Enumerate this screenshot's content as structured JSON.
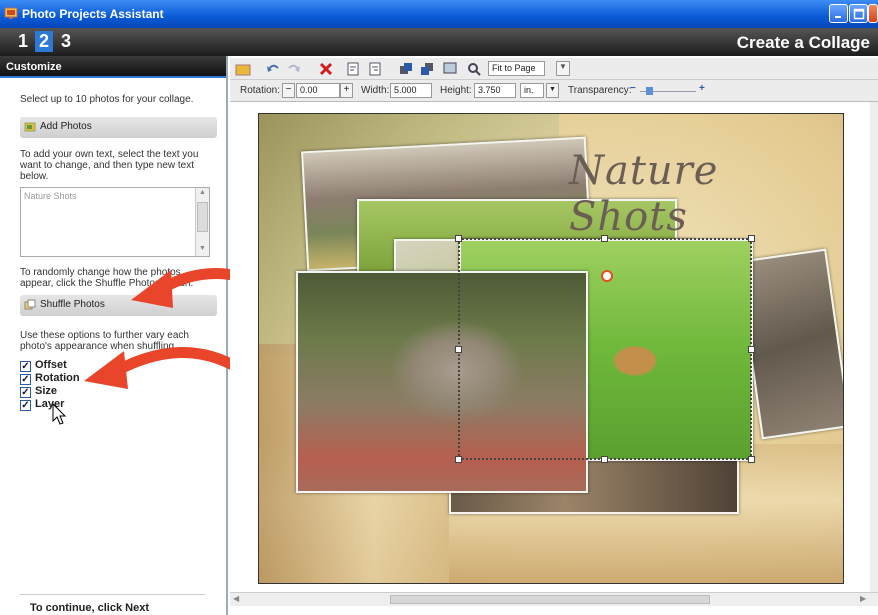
{
  "window": {
    "title": "Photo Projects Assistant"
  },
  "steps": {
    "s1": "1",
    "s2": "2",
    "s3": "3"
  },
  "header": {
    "title": "Create a Collage"
  },
  "panel": {
    "heading": "Customize",
    "intro": "Select up to 10 photos for your collage.",
    "add_photos_label": "Add Photos",
    "text_instructions": "To add your own text, select the text you want to change, and then type new text below.",
    "text_value": "Nature Shots",
    "shuffle_instructions": "To randomly change how the photos appear, click the Shuffle Photos button.",
    "shuffle_label": "Shuffle Photos",
    "options_instructions": "Use these options to further vary each photo's appearance when shuffling.",
    "options": [
      {
        "label": "Offset",
        "checked": true
      },
      {
        "label": "Rotation",
        "checked": true
      },
      {
        "label": "Size",
        "checked": true
      },
      {
        "label": "Layer",
        "checked": true
      }
    ],
    "footer": "To continue, click Next"
  },
  "toolbar": {
    "fit_value": "Fit to Page",
    "rotation_label": "Rotation:",
    "rotation_value": "0.00",
    "width_label": "Width:",
    "width_value": "5.000",
    "height_label": "Height:",
    "height_value": "3.750",
    "unit_value": "in.",
    "transparency_label": "Transparency:"
  },
  "canvas": {
    "title_text": "Nature Shots"
  },
  "colors": {
    "accent": "#2c7ad6",
    "titlebar": "#0a5ad6",
    "arrow": "#e8452a"
  }
}
